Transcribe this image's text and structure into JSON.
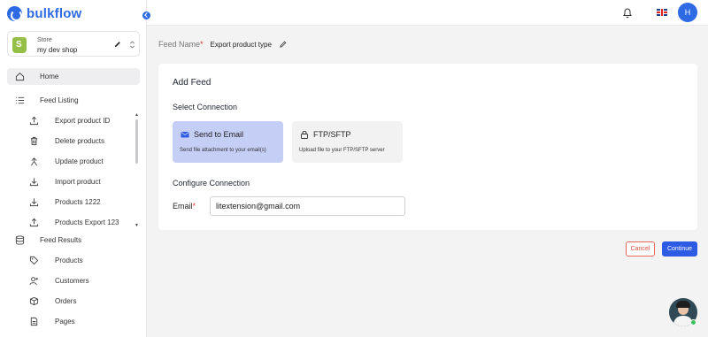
{
  "brand": {
    "name": "bulkflow",
    "accent": "#2d6ae3"
  },
  "store": {
    "label": "Store",
    "name": "my dev shop",
    "logo_icon": "shopify-icon"
  },
  "sidebar": {
    "items": [
      {
        "label": "Home",
        "icon": "home-icon",
        "active": true
      },
      {
        "label": "Feed Listing",
        "icon": "list-icon"
      },
      {
        "label": "Export product ID",
        "icon": "upload-icon",
        "sub": true
      },
      {
        "label": "Delete products",
        "icon": "trash-icon",
        "sub": true
      },
      {
        "label": "Update product",
        "icon": "update-icon",
        "sub": true
      },
      {
        "label": "Import product",
        "icon": "download-icon",
        "sub": true
      },
      {
        "label": "Products 1222",
        "icon": "download-icon",
        "sub": true
      },
      {
        "label": "Products Export 123",
        "icon": "upload-icon",
        "sub": true
      },
      {
        "label": "Feed Results",
        "icon": "database-icon"
      },
      {
        "label": "Products",
        "icon": "tag-icon",
        "sub": true
      },
      {
        "label": "Customers",
        "icon": "user-plus-icon",
        "sub": true
      },
      {
        "label": "Orders",
        "icon": "box-icon",
        "sub": true
      },
      {
        "label": "Pages",
        "icon": "page-icon",
        "sub": true
      }
    ]
  },
  "header": {
    "avatar_initial": "H",
    "language_flag": "uk-flag-icon"
  },
  "feed": {
    "name_label": "Feed Name",
    "required_mark": "*",
    "name_value": "Export product type"
  },
  "card": {
    "title": "Add Feed",
    "select_connection": "Select Connection",
    "connections": [
      {
        "name": "Send to Email",
        "description": "Send file attachment to your email(s)",
        "selected": true,
        "icon": "mail-icon"
      },
      {
        "name": "FTP/SFTP",
        "description": "Upload file to your FTP/SFTP server",
        "selected": false,
        "icon": "lock-icon"
      }
    ],
    "configure_connection": "Configure Connection",
    "email_label": "Email",
    "required_mark": "*",
    "email_value": "litextension@gmail.com"
  },
  "actions": {
    "cancel": "Cancel",
    "continue": "Continue"
  }
}
